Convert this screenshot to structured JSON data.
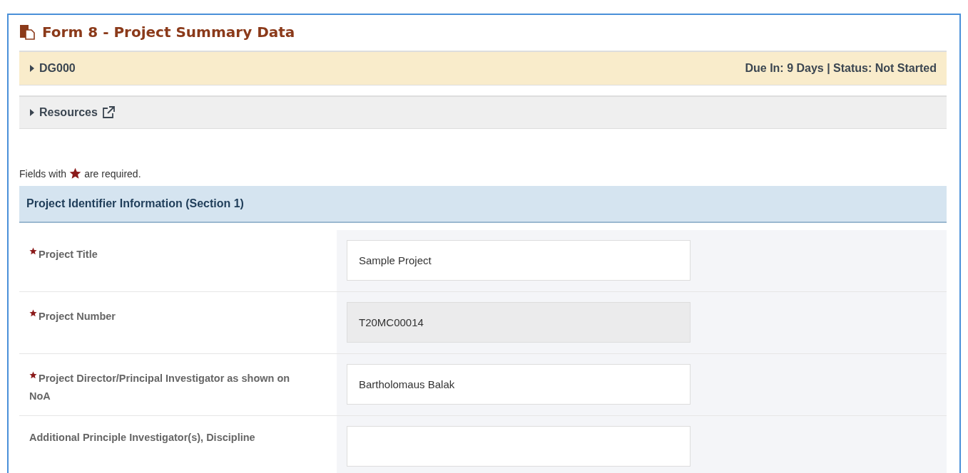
{
  "title": "Form 8 - Project Summary Data",
  "panels": [
    {
      "kind": "due",
      "label": "DG000",
      "expanded": false,
      "status": "Due In: 9 Days | Status: Not Started"
    },
    {
      "kind": "link",
      "label": "Resources",
      "expanded": false
    }
  ],
  "required_note": {
    "before": "Fields with",
    "after": "are required."
  },
  "section": {
    "title": "Project Identifier Information (Section 1)",
    "fields": [
      {
        "label": "Project Title",
        "required": true,
        "value": "Sample Project",
        "disabled": false
      },
      {
        "label": "Project Number",
        "required": true,
        "value": "T20MC00014",
        "disabled": true
      },
      {
        "label": "Project Director/Principal Investigator as shown on NoA",
        "required": true,
        "value": "Bartholomaus Balak",
        "disabled": false
      },
      {
        "label": "Additional Principle Investigator(s), Discipline",
        "required": false,
        "disabled": false
      }
    ]
  }
}
